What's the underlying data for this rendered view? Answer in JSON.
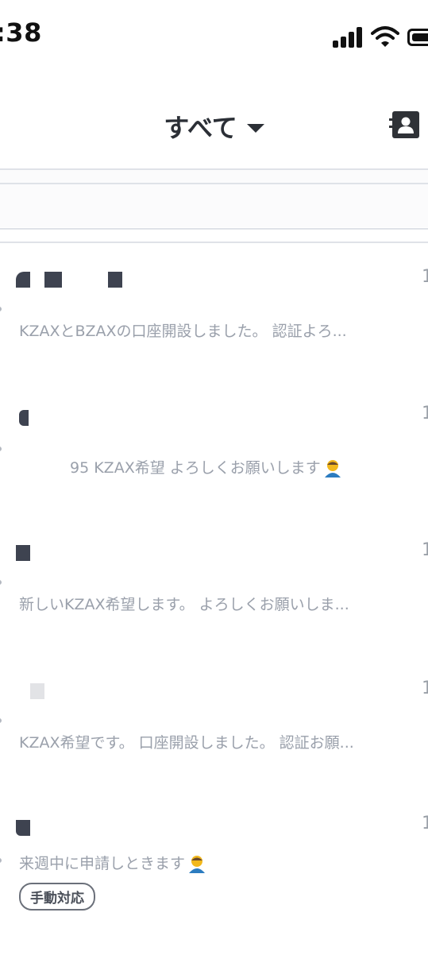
{
  "status_bar": {
    "time": ":38",
    "icons": [
      "cellular-signal-icon",
      "wifi-icon",
      "battery-icon"
    ]
  },
  "header": {
    "title": "すべて",
    "dropdown_icon": "caret-down-icon",
    "action_icon": "contacts-icon"
  },
  "chats": [
    {
      "time": "1",
      "preview": "KZAXとBZAXの口座開設しました。 認証よろ..."
    },
    {
      "time": "1",
      "preview": "95 KZAX希望 よろしくお願いします",
      "emoji": "bowing-person-emoji"
    },
    {
      "time": "1",
      "preview": "新しいKZAX希望します。 よろしくお願いしま..."
    },
    {
      "time": "1",
      "preview": "KZAX希望です。 口座開設しました。 認証お願..."
    },
    {
      "time": "1",
      "preview": "来週中に申請しときます",
      "emoji": "bowing-person-emoji",
      "tag": "手動対応"
    }
  ],
  "colors": {
    "text_primary": "#2b2f36",
    "text_secondary": "#9aa0ab",
    "divider": "#dfe2e8",
    "tag_border": "#6b707a"
  }
}
